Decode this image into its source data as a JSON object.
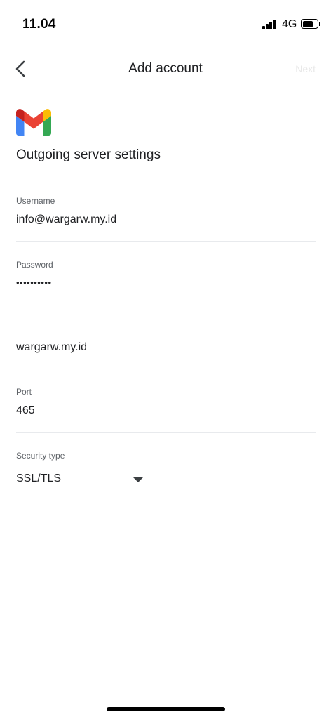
{
  "status_bar": {
    "time": "11.04",
    "network": "4G",
    "signal_icon": "cellular-signal-icon",
    "battery_icon": "battery-icon"
  },
  "app_bar": {
    "title": "Add account",
    "next_label": "Next",
    "back_icon": "chevron-left-icon",
    "next_color": "#e8e8e8"
  },
  "logo": {
    "icon": "gmail-logo"
  },
  "heading": "Outgoing server settings",
  "fields": {
    "username": {
      "label": "Username",
      "value": "info@wargarw.my.id"
    },
    "password": {
      "label": "Password",
      "value": "••••••••••"
    },
    "server": {
      "label": "",
      "value": "wargarw.my.id"
    },
    "port": {
      "label": "Port",
      "value": "465"
    },
    "security": {
      "label": "Security type",
      "value": "SSL/TLS",
      "icon": "dropdown-arrow-icon"
    }
  }
}
